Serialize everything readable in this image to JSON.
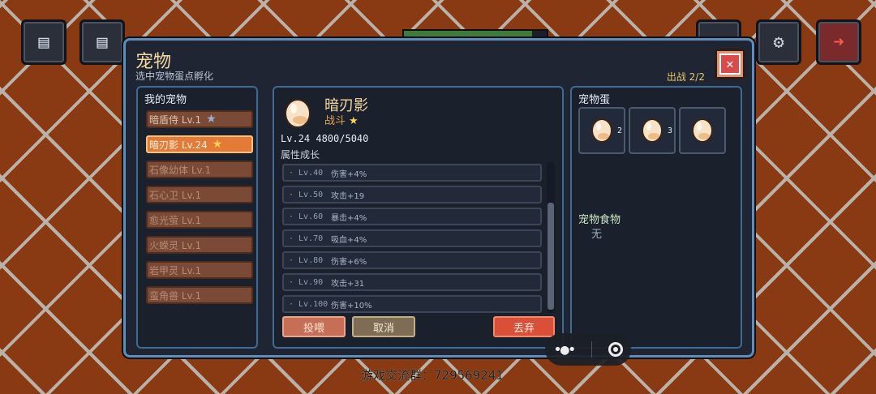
{
  "hud": {
    "buttons": [
      {
        "name": "save-upload-icon",
        "glyph": "💾"
      },
      {
        "name": "save-download-icon",
        "glyph": "💾"
      },
      {
        "name": "inventory-icon",
        "glyph": "▣"
      },
      {
        "name": "settings-icon",
        "glyph": "⚙"
      },
      {
        "name": "exit-icon",
        "glyph": "➜"
      }
    ]
  },
  "panel": {
    "title": "宠物",
    "subtitle": "选中宠物蛋点孵化",
    "deploy": "出战 2/2"
  },
  "pet_list": {
    "title": "我的宠物",
    "items": [
      {
        "label": "暗盾侍 Lv.1",
        "star": "★"
      },
      {
        "label": "暗刃影 Lv.24",
        "star": "★"
      },
      {
        "label": "石像幼体 Lv.1",
        "star": ""
      },
      {
        "label": "石心卫 Lv.1",
        "star": ""
      },
      {
        "label": "愈光萤 Lv.1",
        "star": ""
      },
      {
        "label": "火蝾灵 Lv.1",
        "star": ""
      },
      {
        "label": "岩甲灵 Lv.1",
        "star": ""
      },
      {
        "label": "蛮角兽 Lv.1",
        "star": ""
      }
    ]
  },
  "detail": {
    "name": "暗刃影",
    "type": "战斗",
    "star": "★",
    "level_line": "Lv.24  4800/5040",
    "growth_label": "属性成长",
    "growth": [
      {
        "lv": "· Lv.40",
        "bonus": "伤害+4%"
      },
      {
        "lv": "· Lv.50",
        "bonus": "攻击+19"
      },
      {
        "lv": "· Lv.60",
        "bonus": "暴击+4%"
      },
      {
        "lv": "· Lv.70",
        "bonus": "吸血+4%"
      },
      {
        "lv": "· Lv.80",
        "bonus": "伤害+6%"
      },
      {
        "lv": "· Lv.90",
        "bonus": "攻击+31"
      },
      {
        "lv": "· Lv.100",
        "bonus": "伤害+10%"
      }
    ],
    "buttons": {
      "feed": "投喂",
      "cancel": "取消",
      "discard": "丢弃"
    }
  },
  "eggs": {
    "title": "宠物蛋",
    "slots": [
      {
        "count": "2"
      },
      {
        "count": "3"
      },
      {
        "count": ""
      }
    ],
    "food_label": "宠物食物",
    "food_value": "无"
  },
  "footer": "游戏交流群：729569241",
  "colors": {
    "accent": "#5d8db8",
    "active": "#e37a38",
    "danger": "#d94f38"
  }
}
